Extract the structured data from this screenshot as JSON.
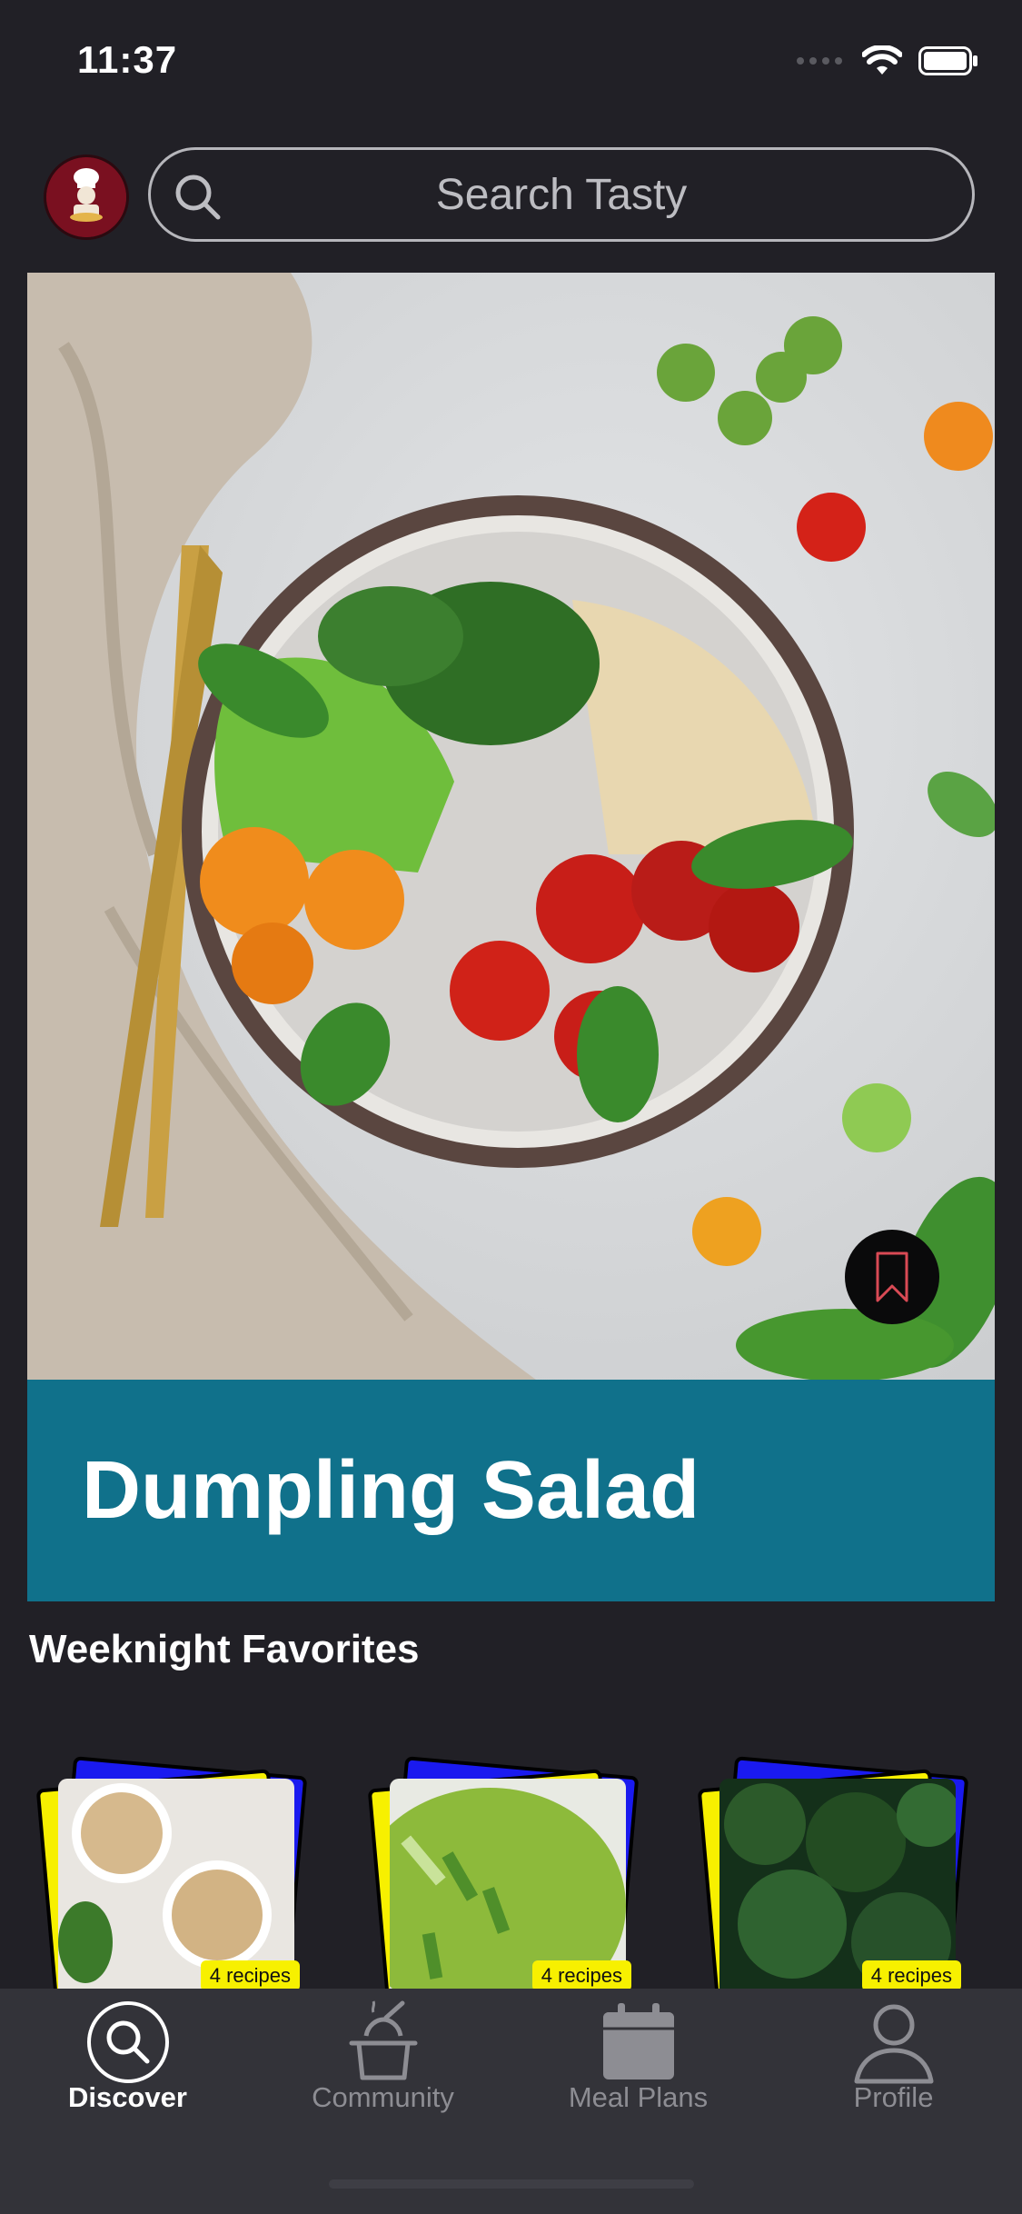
{
  "status_bar": {
    "time": "11:37"
  },
  "header": {
    "search_placeholder": "Search Tasty"
  },
  "hero": {
    "title": "Dumpling Salad"
  },
  "section": {
    "title": "Weeknight Favorites"
  },
  "collections": [
    {
      "count_label": "4 recipes"
    },
    {
      "count_label": "4 recipes"
    },
    {
      "count_label": "4 recipes"
    }
  ],
  "tabbar": {
    "tabs": [
      {
        "label": "Discover",
        "icon": "discover-icon",
        "active": true
      },
      {
        "label": "Community",
        "icon": "community-icon",
        "active": false
      },
      {
        "label": "Meal Plans",
        "icon": "meal-plans-icon",
        "active": false
      },
      {
        "label": "Profile",
        "icon": "profile-icon",
        "active": false
      }
    ]
  },
  "colors": {
    "background": "#212026",
    "banner": "#10718b",
    "tabbar": "#333339",
    "card_blue": "#1a1aef",
    "card_yellow": "#f7f000"
  }
}
